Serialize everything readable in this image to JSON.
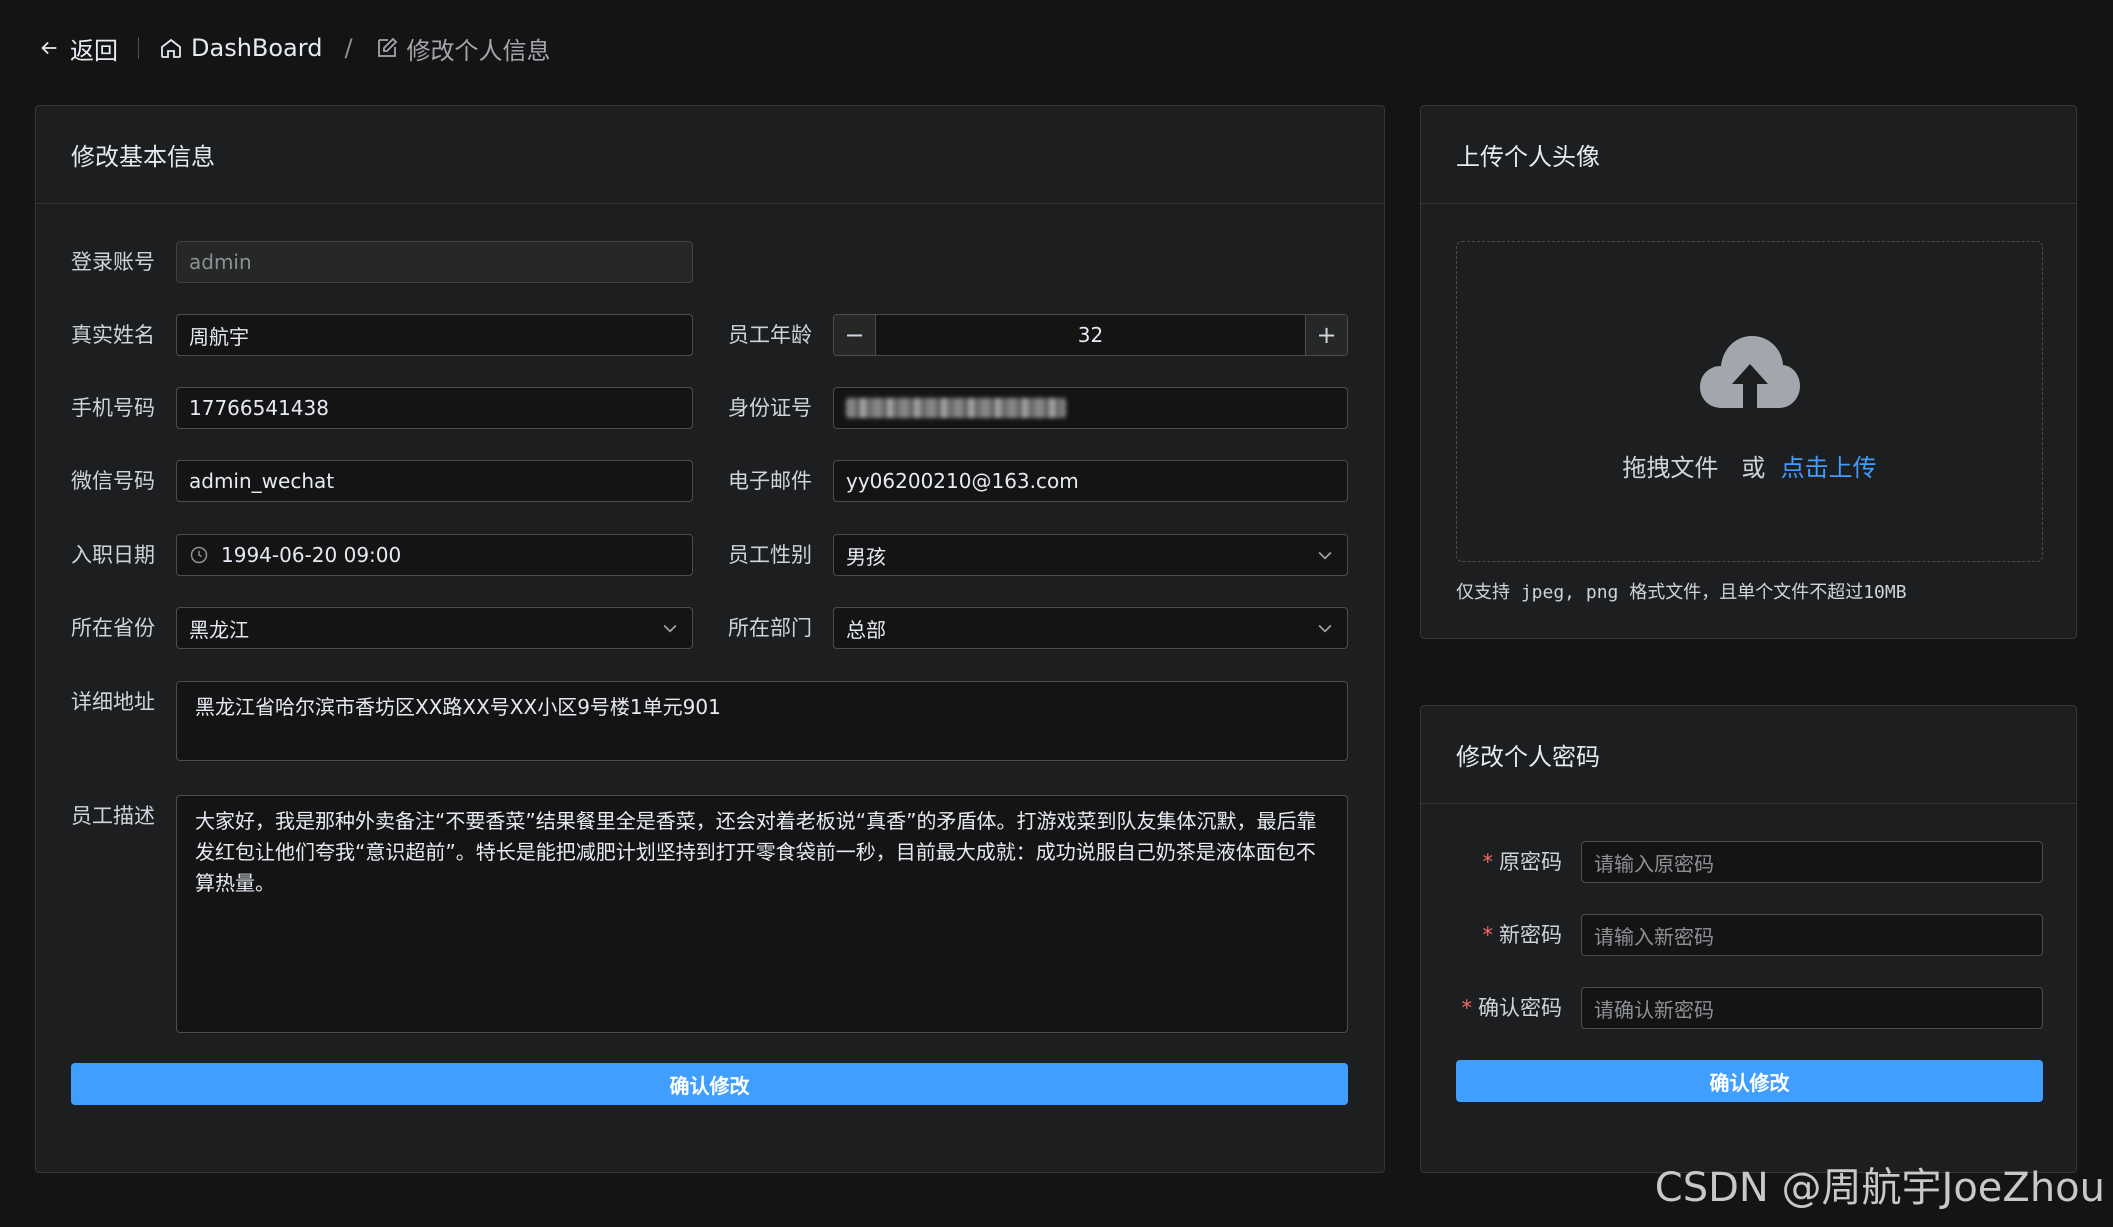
{
  "topbar": {
    "back_label": "返回",
    "crumb_home": "DashBoard",
    "crumb_separator": "/",
    "crumb_current": "修改个人信息"
  },
  "basic": {
    "title": "修改基本信息",
    "account": {
      "label": "登录账号",
      "value": "admin"
    },
    "name": {
      "label": "真实姓名",
      "value": "周航宇"
    },
    "age": {
      "label": "员工年龄",
      "value": "32"
    },
    "phone": {
      "label": "手机号码",
      "value": "17766541438"
    },
    "id_card": {
      "label": "身份证号"
    },
    "wechat": {
      "label": "微信号码",
      "value": "admin_wechat"
    },
    "email": {
      "label": "电子邮件",
      "value": "yy06200210@163.com"
    },
    "join_date": {
      "label": "入职日期",
      "value": "1994-06-20 09:00"
    },
    "gender": {
      "label": "员工性别",
      "value": "男孩"
    },
    "province": {
      "label": "所在省份",
      "value": "黑龙江"
    },
    "department": {
      "label": "所在部门",
      "value": "总部"
    },
    "address": {
      "label": "详细地址",
      "value": "黑龙江省哈尔滨市香坊区XX路XX号XX小区9号楼1单元901"
    },
    "description": {
      "label": "员工描述",
      "value": "大家好，我是那种外卖备注“不要香菜”结果餐里全是香菜，还会对着老板说“真香”的矛盾体。打游戏菜到队友集体沉默，最后靠发红包让他们夸我“意识超前”。特长是能把减肥计划坚持到打开零食袋前一秒，目前最大成就：成功说服自己奶茶是液体面包不算热量。"
    },
    "submit_label": "确认修改"
  },
  "avatar": {
    "title": "上传个人头像",
    "drag_text": "拖拽文件",
    "or_text": "或",
    "click_text": "点击上传",
    "tip": "仅支持 jpeg, png 格式文件，且单个文件不超过10MB"
  },
  "password": {
    "title": "修改个人密码",
    "required_mark": "*",
    "old": {
      "label": "原密码",
      "placeholder": "请输入原密码"
    },
    "new": {
      "label": "新密码",
      "placeholder": "请输入新密码"
    },
    "confirm": {
      "label": "确认密码",
      "placeholder": "请确认新密码"
    },
    "submit_label": "确认修改"
  },
  "watermark": "CSDN @周航宇JoeZhou",
  "colors": {
    "primary": "#409eff",
    "required": "#f56c6c",
    "background": "#141414",
    "card": "#1d1e1f"
  }
}
